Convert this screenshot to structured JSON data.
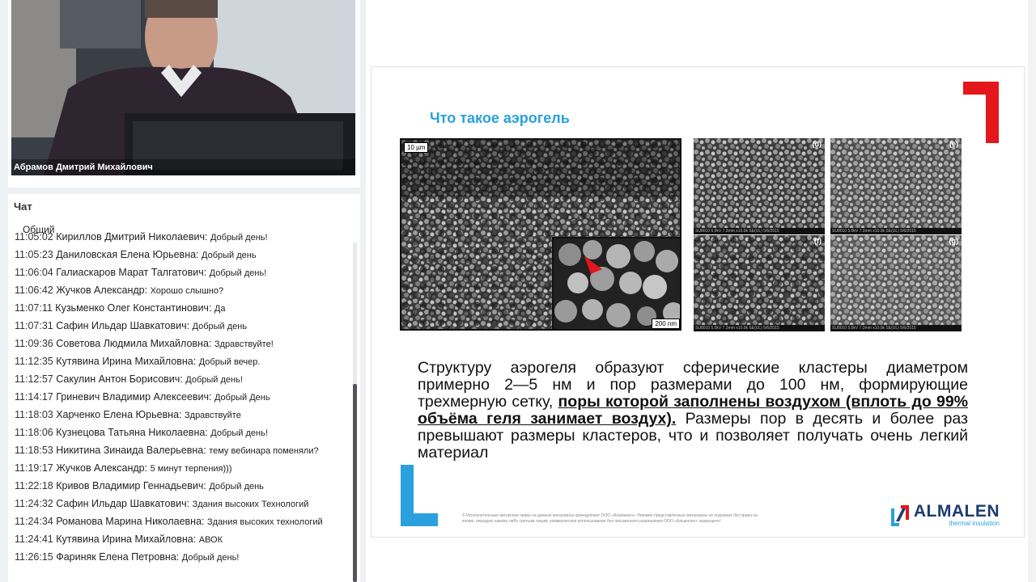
{
  "video": {
    "presenter_name": "Абрамов Дмитрий Михайлович"
  },
  "chat": {
    "title": "Чат",
    "tab": "Общий",
    "messages": [
      {
        "time": "11:05:02",
        "name": "Кириллов Дмитрий Николаевич:",
        "text": "Добрый день!"
      },
      {
        "time": "11:05:23",
        "name": "Даниловская Елена Юрьевна:",
        "text": "Добрый день"
      },
      {
        "time": "11:06:04",
        "name": "Галиаскаров Марат Талгатович:",
        "text": "Добрый день!"
      },
      {
        "time": "11:06:42",
        "name": "Жучков Александр:",
        "text": "Хорошо слышно?"
      },
      {
        "time": "11:07:11",
        "name": "Кузьменко Олег Константинович:",
        "text": "Да"
      },
      {
        "time": "11:07:31",
        "name": "Сафин Ильдар Шавкатович:",
        "text": "Добрый день"
      },
      {
        "time": "11:09:36",
        "name": "Советова Людмила Михайловна:",
        "text": "Здравствуйте!"
      },
      {
        "time": "11:12:35",
        "name": "Кутявина Ирина Михайловна:",
        "text": "Добрый вечер."
      },
      {
        "time": "11:12:57",
        "name": "Сакулин Антон Борисович:",
        "text": "Добрый день!"
      },
      {
        "time": "11:14:17",
        "name": "Гриневич Владимир Алексеевич:",
        "text": "Добрый День"
      },
      {
        "time": "11:18:03",
        "name": "Харченко Елена Юрьевна:",
        "text": "Здравствуйте"
      },
      {
        "time": "11:18:06",
        "name": "Кузнецова Татьяна Николаевна:",
        "text": "Добрый день!"
      },
      {
        "time": "11:18:53",
        "name": "Никитина Зинаида Валерьевна:",
        "text": "тему вебинара поменяли?"
      },
      {
        "time": "11:19:17",
        "name": "Жучков Александр:",
        "text": "5 минут терпения)))"
      },
      {
        "time": "11:22:18",
        "name": "Кривов Владимир Геннадьевич:",
        "text": "Добрый день"
      },
      {
        "time": "11:24:32",
        "name": "Сафин Ильдар Шавкатович:",
        "text": "Здания высоких Технологий"
      },
      {
        "time": "11:24:34",
        "name": "Романова Марина Николаевна:",
        "text": "Здания высоких технологий"
      },
      {
        "time": "11:24:41",
        "name": "Кутявина Ирина Михайловна:",
        "text": "АВОК"
      },
      {
        "time": "11:26:15",
        "name": "Фариняк Елена Петровна:",
        "text": "Добрый день!"
      }
    ]
  },
  "slide": {
    "title": "Что такое аэрогель",
    "scale_main": "10 µm",
    "scale_inset": "200 nm",
    "panels": [
      "(d)",
      "(e)",
      "(f)",
      "(g)"
    ],
    "panel_footer": "SU8010 5.0kV 7.3mm x10.0k SE(UL) 5/6/2015",
    "panel_scale": "5.00µm",
    "body_part1": "Структуру аэрогеля образуют сферические кластеры диаметром примерно 2—5 нм и пор размерами до 100 нм, формирующие трехмерную сетку,",
    "body_highlight": "поры которой заполнены воздухом (вплоть до 99% объёма геля занимает воздух).",
    "body_part2": "Размеры пор в десять и более раз превышают размеры кластеров, что и позволяет получать очень легкий материал",
    "footer_note": "© Исключительные авторские права на данные материалы принадлежат ООО «Альмален». Никакие представленные материалы не подлежат без права на копию, передачу какому-либо третьим лицам, коммерческое использование без письменного разрешения ООО «Альмален» запрещено!",
    "logo_text": "ALMALEN",
    "logo_sub": "thermal insulation",
    "colors": {
      "title": "#2aa0de",
      "red_corner": "#e3161b",
      "blue_corner": "#2aa0de",
      "logo": "#1c3c6f"
    }
  }
}
